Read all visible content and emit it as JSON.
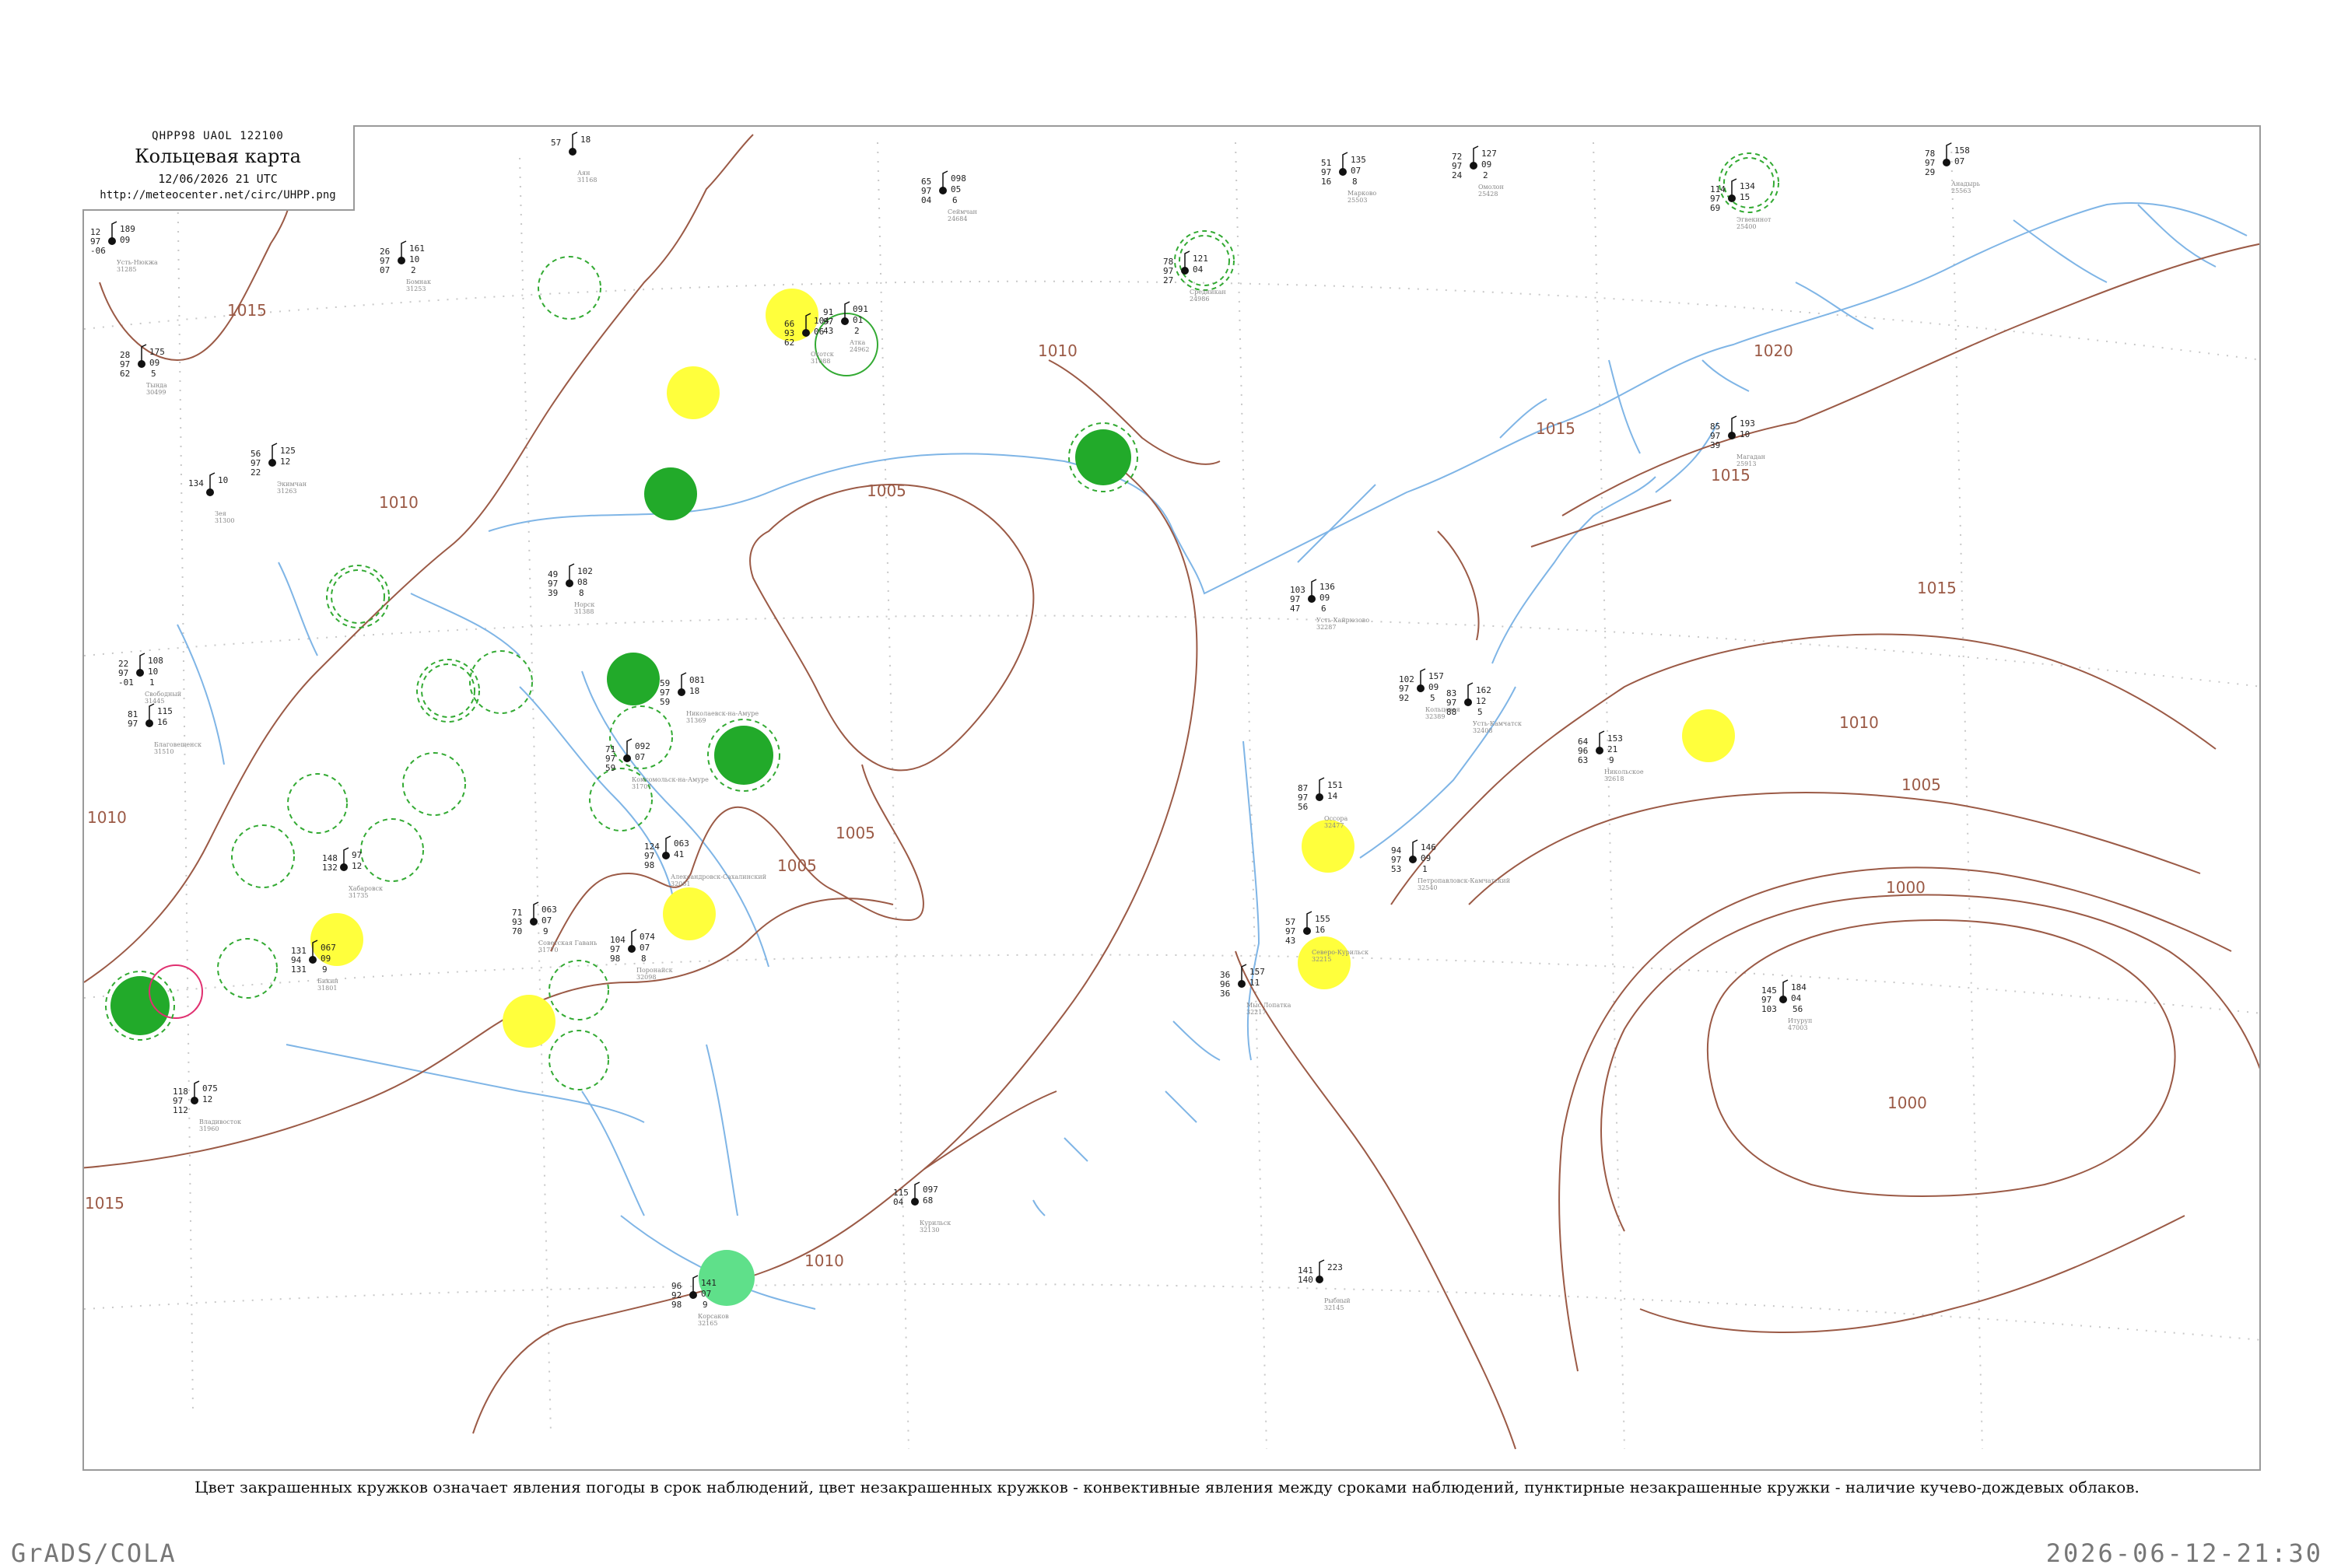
{
  "header": {
    "code": "QHPP98  UAOL  122100",
    "title": "Кольцевая карта",
    "date": "12/06/2026 21 UTC",
    "url": "http://meteocenter.net/circ/UHPP.png"
  },
  "caption": "Цвет закрашенных кружков означает явления погоды в срок наблюдений, цвет незакрашенных кружков - конвективные явления между сроками наблюдений, пунктирные незакрашенные кружки - наличие кучево-дождевых облаков.",
  "footer": {
    "left": "GrADS/COLA",
    "right": "2026-06-12-21:30"
  },
  "colors": {
    "isobar": "#9b5a46",
    "river": "#7fb5e6",
    "rain": "#22aa2a",
    "fog": "#ffff3c",
    "showers": "#5fe08a",
    "thunder": "#e03070",
    "cb_dash": "#33aa33"
  },
  "isobar_labels": [
    "1015",
    "1010",
    "1005",
    "1005",
    "1005",
    "1010",
    "1010",
    "1015",
    "1010",
    "1015",
    "1020",
    "1015",
    "1015",
    "1010",
    "1005",
    "1000",
    "1000"
  ],
  "stations": [
    {
      "name": "Усть-Нюкжа",
      "code": "31285",
      "values": [
        "12",
        "189",
        "97",
        "09",
        "-06"
      ]
    },
    {
      "name": "Тында",
      "code": "30499",
      "values": [
        "28",
        "175",
        "97",
        "09",
        "62",
        "5"
      ]
    },
    {
      "name": "Зея",
      "code": "31300",
      "values": [
        "134",
        "10"
      ]
    },
    {
      "name": "Экимчан",
      "code": "31263",
      "values": [
        "56",
        "125",
        "97",
        "12",
        "22"
      ]
    },
    {
      "name": "Бомнак",
      "code": "31253",
      "values": [
        "26",
        "161",
        "97",
        "10",
        "07",
        "2"
      ]
    },
    {
      "name": "Норск",
      "code": "31388",
      "values": [
        "49",
        "102",
        "97",
        "08",
        "39",
        "8"
      ]
    },
    {
      "name": "Свободный",
      "code": "31445",
      "values": [
        "22",
        "108",
        "97",
        "10",
        "-01",
        "1"
      ]
    },
    {
      "name": "Благовещенск",
      "code": "31510",
      "values": [
        "81",
        "115",
        "97",
        "16"
      ]
    },
    {
      "name": "Аян",
      "code": "31168",
      "values": [
        "57",
        "18"
      ]
    },
    {
      "name": "Охотск",
      "code": "31088",
      "values": [
        "66",
        "104",
        "93",
        "06",
        "62"
      ]
    },
    {
      "name": "Магадан",
      "code": "25913",
      "values": [
        "85",
        "193",
        "97",
        "10",
        "39"
      ]
    },
    {
      "name": "Николаевск-на-Амуре",
      "code": "31369",
      "values": [
        "59",
        "081",
        "97",
        "18",
        "59"
      ]
    },
    {
      "name": "Комсомольск-на-Амуре",
      "code": "31707",
      "values": [
        "71",
        "092",
        "97",
        "07",
        "59"
      ]
    },
    {
      "name": "Хабаровск",
      "code": "31735",
      "values": [
        "148",
        "97",
        "132",
        "12"
      ]
    },
    {
      "name": "Бикин",
      "code": "31801",
      "values": [
        "131",
        "067",
        "94",
        "09",
        "131",
        "9"
      ]
    },
    {
      "name": "Советская Гавань",
      "code": "31770",
      "values": [
        "71",
        "063",
        "93",
        "07",
        "70",
        "9"
      ]
    },
    {
      "name": "Александровск-Сахалинский",
      "code": "32061",
      "values": [
        "124",
        "063",
        "97",
        "41",
        "98"
      ]
    },
    {
      "name": "Поронайск",
      "code": "32098",
      "values": [
        "104",
        "074",
        "97",
        "07",
        "98",
        "8"
      ]
    },
    {
      "name": "Корсаков",
      "code": "32165",
      "values": [
        "96",
        "141",
        "92",
        "07",
        "98",
        "9"
      ]
    },
    {
      "name": "Владивосток",
      "code": "31960",
      "values": [
        "118",
        "075",
        "97",
        "12",
        "112"
      ]
    },
    {
      "name": "Усть-Хайрюзово",
      "code": "32287",
      "values": [
        "103",
        "136",
        "97",
        "09",
        "47",
        "6"
      ]
    },
    {
      "name": "Петропавловск-Камчатский",
      "code": "32540",
      "values": [
        "94",
        "146",
        "97",
        "09",
        "53",
        "1"
      ]
    },
    {
      "name": "Северо-Курильск",
      "code": "32215",
      "values": [
        "57",
        "155",
        "97",
        "16",
        "43"
      ]
    },
    {
      "name": "Кольцевая",
      "code": "32389",
      "values": [
        "102",
        "157",
        "97",
        "09",
        "92",
        "5"
      ]
    },
    {
      "name": "Усть-Камчатск",
      "code": "32408",
      "values": [
        "83",
        "162",
        "97",
        "12",
        "88",
        "5"
      ]
    },
    {
      "name": "Никольское",
      "code": "32618",
      "values": [
        "64",
        "153",
        "96",
        "21",
        "63",
        "9"
      ]
    },
    {
      "name": "Оссора",
      "code": "32477",
      "values": [
        "87",
        "151",
        "97",
        "14",
        "56"
      ]
    },
    {
      "name": "Эгвекинот",
      "code": "25400",
      "values": [
        "114",
        "134",
        "97",
        "15",
        "69"
      ]
    },
    {
      "name": "Анадырь",
      "code": "25563",
      "values": [
        "78",
        "158",
        "97",
        "07",
        "29"
      ]
    },
    {
      "name": "Марково",
      "code": "25503",
      "values": [
        "51",
        "135",
        "97",
        "07",
        "16",
        "8"
      ]
    },
    {
      "name": "Омолон",
      "code": "25428",
      "values": [
        "72",
        "127",
        "97",
        "09",
        "24",
        "2"
      ]
    },
    {
      "name": "Сеймчан",
      "code": "24684",
      "values": [
        "65",
        "098",
        "97",
        "05",
        "04",
        "6"
      ]
    },
    {
      "name": "Средникан",
      "code": "24986",
      "values": [
        "78",
        "121",
        "97",
        "04",
        "27"
      ]
    },
    {
      "name": "Атка",
      "code": "24962",
      "values": [
        "91",
        "091",
        "97",
        "01",
        "43",
        "2"
      ]
    },
    {
      "name": "Мыс Лопатка",
      "code": "32217",
      "values": [
        "36",
        "157",
        "96",
        "11",
        "36"
      ]
    },
    {
      "name": "Итуруп",
      "code": "47003",
      "values": [
        "145",
        "184",
        "97",
        "04",
        "103",
        "56"
      ]
    },
    {
      "name": "Курильск",
      "code": "32130",
      "values": [
        "115",
        "097",
        "04",
        "68"
      ]
    },
    {
      "name": "Рыбный",
      "code": "32145",
      "values": [
        "141",
        "223",
        "140"
      ]
    }
  ]
}
